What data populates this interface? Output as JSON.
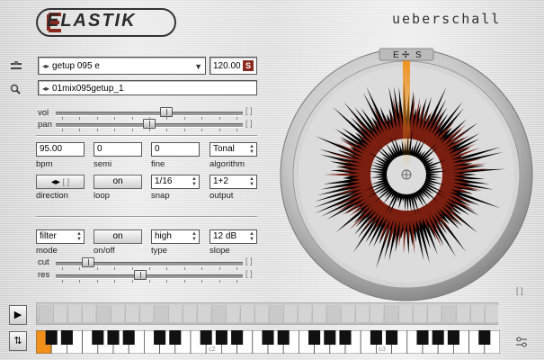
{
  "header": {
    "logo_text": "ELASTIK",
    "brand": "ueberschall"
  },
  "loop": {
    "name": "getup 095 e",
    "tempo": "120.00",
    "save_label": "S",
    "file": "01mix095getup_1"
  },
  "mixer": {
    "vol_label": "vol",
    "vol_level": 0.6,
    "pan_label": "pan",
    "pan_level": 0.5,
    "bracket": "[ ]"
  },
  "params": {
    "bpm": {
      "value": "95.00",
      "label": "bpm"
    },
    "semi": {
      "value": "0",
      "label": "semi"
    },
    "fine": {
      "value": "0",
      "label": "fine"
    },
    "algorithm": {
      "value": "Tonal",
      "label": "algorithm"
    }
  },
  "row2": {
    "direction": {
      "label": "direction",
      "play_icon": "play-arrows-icon",
      "bracket": "[ ]"
    },
    "loop": {
      "value": "on",
      "label": "loop"
    },
    "snap": {
      "value": "1/16",
      "label": "snap"
    },
    "output": {
      "value": "1+2",
      "label": "output"
    }
  },
  "filter": {
    "mode": {
      "value": "filter",
      "label": "mode"
    },
    "onoff": {
      "value": "on",
      "label": "on/off"
    },
    "type": {
      "value": "high",
      "label": "type"
    },
    "slope": {
      "value": "12 dB",
      "label": "slope"
    },
    "cut": {
      "label": "cut",
      "level": 0.15
    },
    "res": {
      "label": "res",
      "level": 0.45
    },
    "bracket": "[ ]"
  },
  "disk": {
    "compass_left": "E",
    "compass_right": "S",
    "bracket": "[ ]"
  },
  "keyboard": {
    "c2": "c2",
    "c3": "c3"
  },
  "colors": {
    "accent": "#8a2a1e",
    "waveform": "#7a1e10",
    "highlight": "#f0901a"
  },
  "icons": {
    "loop_icon": "sliders-icon",
    "search": "magnifier-icon",
    "play": "play-icon",
    "swap": "swap-icon",
    "settings": "settings-icon"
  }
}
